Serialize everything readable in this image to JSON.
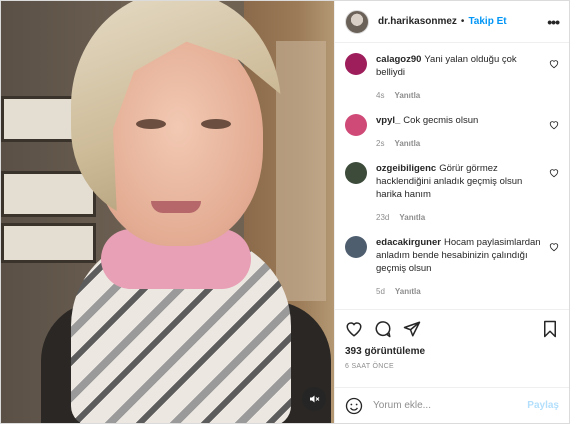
{
  "header": {
    "username": "dr.harikasonmez",
    "separator": "•",
    "follow_label": "Takip Et",
    "more_icon": "more-options-icon"
  },
  "comments": [
    {
      "user": "calagoz90",
      "text": "Yani yalan olduğu çok belliydi",
      "time": "4s",
      "reply": "Yanıtla",
      "avatar_color": "#9e1e5c"
    },
    {
      "user": "vpyl_",
      "text": "Cok gecmis olsun",
      "time": "2s",
      "reply": "Yanıtla",
      "avatar_color": "#d04a78"
    },
    {
      "user": "ozgeibiligenc",
      "text": "Görür görmez hacklendiğini anladık geçmiş olsun harika hanım",
      "time": "23d",
      "reply": "Yanıtla",
      "avatar_color": "#3c4b3a"
    },
    {
      "user": "edacakirguner",
      "text": "Hocam paylasimlardan anladım bende hesabinizin çalındığı geçmiş olsun",
      "time": "5d",
      "reply": "Yanıtla",
      "avatar_color": "#4f5e6f"
    }
  ],
  "actions": {
    "views": "393 görüntüleme",
    "time_ago": "6 SAAT ÖNCE"
  },
  "add_comment": {
    "placeholder": "Yorum ekle...",
    "post_label": "Paylaş"
  },
  "colors": {
    "link_blue": "#0095f6",
    "post_disabled": "#b2dffc"
  }
}
